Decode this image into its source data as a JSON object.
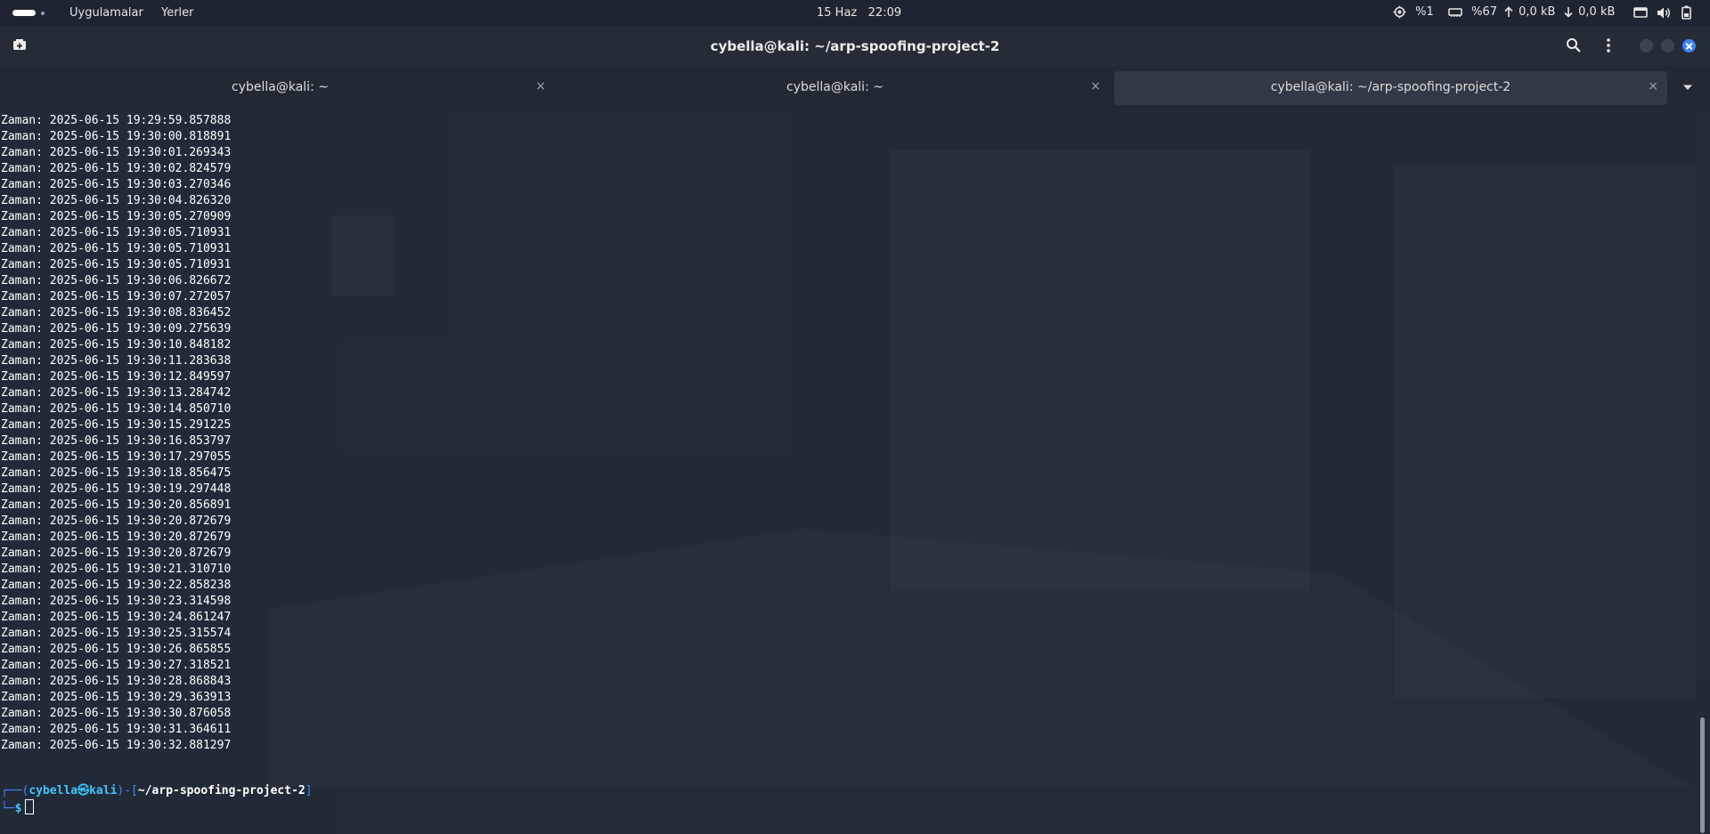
{
  "top_panel": {
    "menu_apps": "Uygulamalar",
    "menu_places": "Yerler",
    "date": "15 Haz",
    "time": "22:09",
    "cpu": "%1",
    "memory": "%67",
    "upload": "0,0 kB",
    "download": "0,0 kB",
    "icons": [
      "activities-indicator",
      "cpu-icon",
      "memory-icon",
      "upload-arrow-icon",
      "download-arrow-icon",
      "display-icon",
      "volume-icon",
      "battery-icon"
    ]
  },
  "window": {
    "title": "cybella@kali: ~/arp-spoofing-project-2",
    "icons": [
      "new-tab-icon",
      "search-icon",
      "menu-icon",
      "minimize-icon",
      "maximize-icon",
      "close-icon"
    ]
  },
  "tabs": [
    {
      "label": "cybella@kali: ~",
      "active": false
    },
    {
      "label": "cybella@kali: ~",
      "active": false
    },
    {
      "label": "cybella@kali: ~/arp-spoofing-project-2",
      "active": true
    }
  ],
  "tab_close_glyph": "×",
  "terminal": {
    "lines": [
      "Zaman: 2025-06-15 19:29:59.857888",
      "Zaman: 2025-06-15 19:30:00.818891",
      "Zaman: 2025-06-15 19:30:01.269343",
      "Zaman: 2025-06-15 19:30:02.824579",
      "Zaman: 2025-06-15 19:30:03.270346",
      "Zaman: 2025-06-15 19:30:04.826320",
      "Zaman: 2025-06-15 19:30:05.270909",
      "Zaman: 2025-06-15 19:30:05.710931",
      "Zaman: 2025-06-15 19:30:05.710931",
      "Zaman: 2025-06-15 19:30:05.710931",
      "Zaman: 2025-06-15 19:30:06.826672",
      "Zaman: 2025-06-15 19:30:07.272057",
      "Zaman: 2025-06-15 19:30:08.836452",
      "Zaman: 2025-06-15 19:30:09.275639",
      "Zaman: 2025-06-15 19:30:10.848182",
      "Zaman: 2025-06-15 19:30:11.283638",
      "Zaman: 2025-06-15 19:30:12.849597",
      "Zaman: 2025-06-15 19:30:13.284742",
      "Zaman: 2025-06-15 19:30:14.850710",
      "Zaman: 2025-06-15 19:30:15.291225",
      "Zaman: 2025-06-15 19:30:16.853797",
      "Zaman: 2025-06-15 19:30:17.297055",
      "Zaman: 2025-06-15 19:30:18.856475",
      "Zaman: 2025-06-15 19:30:19.297448",
      "Zaman: 2025-06-15 19:30:20.856891",
      "Zaman: 2025-06-15 19:30:20.872679",
      "Zaman: 2025-06-15 19:30:20.872679",
      "Zaman: 2025-06-15 19:30:20.872679",
      "Zaman: 2025-06-15 19:30:21.310710",
      "Zaman: 2025-06-15 19:30:22.858238",
      "Zaman: 2025-06-15 19:30:23.314598",
      "Zaman: 2025-06-15 19:30:24.861247",
      "Zaman: 2025-06-15 19:30:25.315574",
      "Zaman: 2025-06-15 19:30:26.865855",
      "Zaman: 2025-06-15 19:30:27.318521",
      "Zaman: 2025-06-15 19:30:28.868843",
      "Zaman: 2025-06-15 19:30:29.363913",
      "Zaman: 2025-06-15 19:30:30.876058",
      "Zaman: 2025-06-15 19:30:31.364611",
      "Zaman: 2025-06-15 19:30:32.881297"
    ],
    "prompt": {
      "corner_top": "┌──(",
      "user_host": "cybella㉿kali",
      "sep": ")-[",
      "path": "~/arp-spoofing-project-2",
      "close": "]",
      "corner_bottom": "└─",
      "symbol": "$"
    }
  },
  "colors": {
    "panel_bg": "#1e2530",
    "terminal_bg": "#222936",
    "prompt_blue": "#3f86ff",
    "prompt_user": "#3fc6ff",
    "close_button": "#3b84f6"
  }
}
